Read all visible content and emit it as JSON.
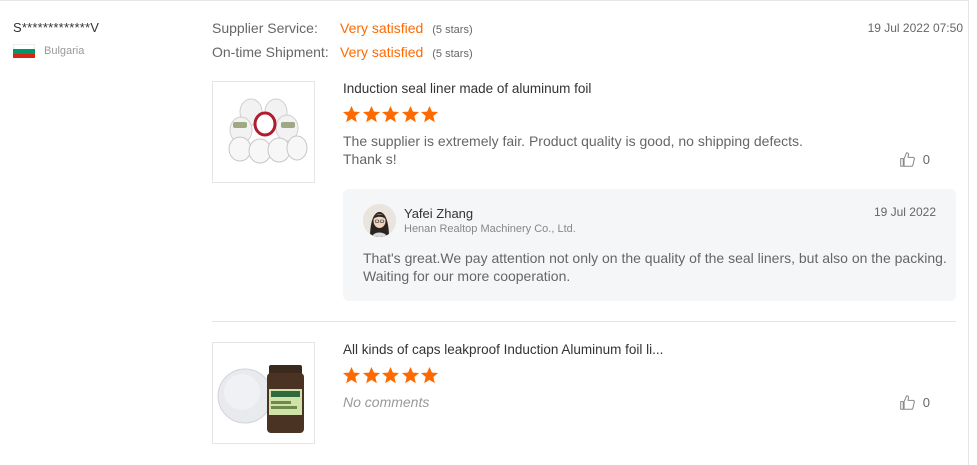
{
  "buyer": {
    "name": "S*************V",
    "country": "Bulgaria"
  },
  "ratings": [
    {
      "label": "Supplier Service:",
      "value": "Very satisfied",
      "stars": "(5 stars)"
    },
    {
      "label": "On-time Shipment:",
      "value": "Very satisfied",
      "stars": "(5 stars)"
    }
  ],
  "review_date": "19 Jul 2022 07:50",
  "products": [
    {
      "title": "Induction seal liner made of aluminum foil",
      "rating": 5,
      "comment": "The supplier is extremely fair. Product quality is good, no shipping defects. Thank s!",
      "likes": "0",
      "reply": {
        "name": "Yafei Zhang",
        "company": "Henan Realtop Machinery Co., Ltd.",
        "date": "19 Jul 2022",
        "text": "That's great.We pay attention not only on the quality of the seal liners, but also on the packing. Waiting for our more cooperation."
      }
    },
    {
      "title": "All kinds of caps leakproof Induction Aluminum foil li...",
      "rating": 5,
      "comment": "No comments",
      "likes": "0"
    }
  ],
  "colors": {
    "accent": "#ff6a00",
    "star": "#ff6a00",
    "reply_bg": "#f5f6f8"
  },
  "icons": {
    "like": "thumbs-up-icon",
    "star": "star-icon",
    "flag": "bulgaria-flag-icon"
  }
}
